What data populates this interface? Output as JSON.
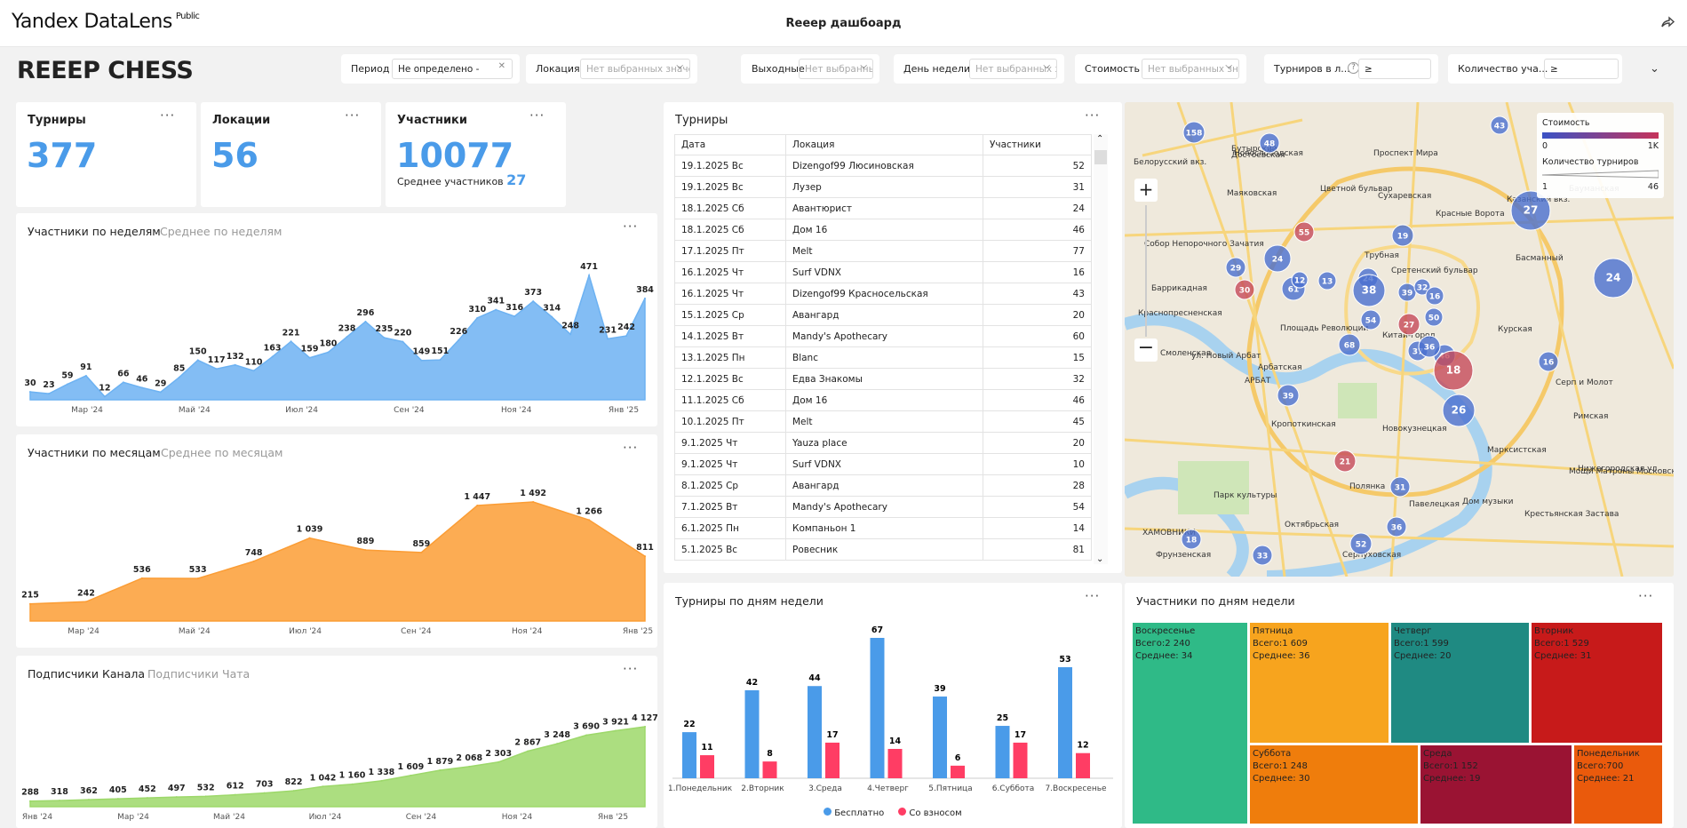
{
  "app": {
    "logo": "Yandex DataLens",
    "logo_badge": "Public",
    "title": "Reeep дашбоард",
    "brand": "REEEP CHESS"
  },
  "filters": [
    {
      "label": "Период",
      "value": "Не определено - Не определено",
      "clear": "✕"
    },
    {
      "label": "Локация",
      "placeholder": "Нет выбранных значений"
    },
    {
      "label": "Выходные",
      "placeholder": "Нет выбранных значений"
    },
    {
      "label": "День недели",
      "placeholder": "Нет выбранных значений"
    },
    {
      "label": "Стоимость",
      "placeholder": "Нет выбранных значений"
    },
    {
      "label": "Турниров в л...",
      "value": "≥"
    },
    {
      "label": "Количество уча...",
      "value": "≥"
    }
  ],
  "kpi": {
    "tournaments_label": "Турниры",
    "tournaments_value": "377",
    "locations_label": "Локации",
    "locations_value": "56",
    "participants_label": "Участники",
    "participants_value": "10077",
    "avg_label": "Среднее участников",
    "avg_value": "27"
  },
  "weekly": {
    "tab1": "Участники по неделям",
    "tab2": "Среднее по неделям"
  },
  "monthly": {
    "tab1": "Участники по месяцам",
    "tab2": "Среднее по месяцам"
  },
  "subs": {
    "tab1": "Подписчики Канала",
    "tab2": "Подписчики Чата"
  },
  "table": {
    "title": "Турниры",
    "headers": [
      "Дата",
      "Локация",
      "Участники"
    ],
    "rows": [
      [
        "19.1.2025 Вс",
        "Dizengof99 Люсиновская",
        "52"
      ],
      [
        "19.1.2025 Вс",
        "Лузер",
        "31"
      ],
      [
        "18.1.2025 Сб",
        "Авантюрист",
        "24"
      ],
      [
        "18.1.2025 Сб",
        "Дом 16",
        "46"
      ],
      [
        "17.1.2025 Пт",
        "Melt",
        "77"
      ],
      [
        "16.1.2025 Чт",
        "Surf VDNX",
        "16"
      ],
      [
        "16.1.2025 Чт",
        "Dizengof99 Красносельская",
        "43"
      ],
      [
        "15.1.2025 Ср",
        "Авангард",
        "20"
      ],
      [
        "14.1.2025 Вт",
        "Mandy's Apothecary",
        "60"
      ],
      [
        "13.1.2025 Пн",
        "Blanc",
        "15"
      ],
      [
        "12.1.2025 Вс",
        "Едва Знакомы",
        "32"
      ],
      [
        "11.1.2025 Сб",
        "Дом 16",
        "46"
      ],
      [
        "10.1.2025 Пт",
        "Melt",
        "45"
      ],
      [
        "9.1.2025 Чт",
        "Yauza place",
        "20"
      ],
      [
        "9.1.2025 Чт",
        "Surf VDNX",
        "10"
      ],
      [
        "8.1.2025 Ср",
        "Авангард",
        "28"
      ],
      [
        "7.1.2025 Вт",
        "Mandy's Apothecary",
        "54"
      ],
      [
        "6.1.2025 Пн",
        "Компаньон 1",
        "14"
      ],
      [
        "5.1.2025 Вс",
        "Ровесник",
        "81"
      ]
    ]
  },
  "map": {
    "legend_cost": "Стоимость",
    "cost_min": "0",
    "cost_max": "1K",
    "legend_count": "Количество турниров",
    "count_min": "1",
    "count_max": "46",
    "labels": [
      "Бутырский",
      "Новослободская",
      "Достоевская",
      "Проспект Мира",
      "Белорусский вкз.",
      "Маяковская",
      "Цветной бульвар",
      "Сухаревская",
      "Красные Ворота",
      "Казанский вкз.",
      "Бауманская",
      "Собор Непорочного Зачатия",
      "Трубная",
      "Баррикадная",
      "Краснопресненская",
      "Сретенский бульвар",
      "Площадь Революции",
      "Китай-город",
      "Курская",
      "Басманный",
      "Смоленская",
      "Арбатская",
      "ул. Новый Арбат",
      "АРБАТ",
      "Серп и Молот",
      "Кропоткинская",
      "Новокузнецкая",
      "Марксистская",
      "Парк культуры",
      "Полянка",
      "Павелецкая",
      "Крестьянская Застава",
      "Октябрьская",
      "ХАМОВНИКИ",
      "Серпуховская",
      "Фрунзенская",
      "Мощи Матроны Московской",
      "Дом музыки",
      "Римская",
      "Нижегородская ул."
    ],
    "bubbles": [
      "158",
      "48",
      "43",
      "27",
      "55",
      "19",
      "24",
      "29",
      "30",
      "61",
      "12",
      "13",
      "24",
      "38",
      "39",
      "32",
      "16",
      "24",
      "54",
      "27",
      "50",
      "68",
      "37",
      "46",
      "18",
      "36",
      "16",
      "39",
      "26",
      "21",
      "31",
      "36",
      "18",
      "52",
      "33"
    ]
  },
  "dow": {
    "title": "Турниры по дням недели",
    "legend_free": "Бесплатно",
    "legend_paid": "Со взносом"
  },
  "tree": {
    "title": "Участники по дням недели",
    "tiles": [
      {
        "name": "Воскресенье",
        "total": "Всего:2 240",
        "avg": "Среднее: 34"
      },
      {
        "name": "Пятница",
        "total": "Всего:1 609",
        "avg": "Среднее: 36"
      },
      {
        "name": "Четверг",
        "total": "Всего:1 599",
        "avg": "Среднее: 20"
      },
      {
        "name": "Вторник",
        "total": "Всего:1 529",
        "avg": "Среднее: 31"
      },
      {
        "name": "Суббота",
        "total": "Всего:1 248",
        "avg": "Среднее: 30"
      },
      {
        "name": "Среда",
        "total": "Всего:1 152",
        "avg": "Среднее: 19"
      },
      {
        "name": "Понедельник",
        "total": "Всего:700",
        "avg": "Среднее: 21"
      }
    ]
  },
  "colors": {
    "blue": "#4a9be9",
    "weekly": "#6db2f2",
    "monthly": "#fb9d35",
    "subs": "#9dd86a",
    "red": "#ff3d64"
  },
  "chart_data": [
    {
      "type": "area",
      "title": "Участники по неделям",
      "x_ticks": [
        "Мар '24",
        "Май '24",
        "Июл '24",
        "Сен '24",
        "Ноя '24",
        "Янв '25"
      ],
      "values": [
        30,
        23,
        59,
        91,
        12,
        66,
        46,
        29,
        85,
        150,
        117,
        132,
        110,
        163,
        221,
        159,
        180,
        238,
        296,
        235,
        220,
        149,
        151,
        226,
        310,
        341,
        316,
        373,
        314,
        248,
        471,
        231,
        242,
        384
      ],
      "labels": [
        "30",
        "23",
        "59",
        "91",
        "12",
        "66",
        "46",
        "29",
        "85",
        "150",
        "117",
        "132",
        "110",
        "163",
        "221",
        "159",
        "180",
        "238",
        "296",
        "235",
        "220",
        "149",
        "151",
        "226",
        "310",
        "341",
        "316",
        "373",
        "314",
        "248",
        "471",
        "231",
        "242",
        "384"
      ]
    },
    {
      "type": "area",
      "title": "Участники по месяцам",
      "x_ticks": [
        "Мар '24",
        "Май '24",
        "Июл '24",
        "Сен '24",
        "Ноя '24",
        "Янв '25"
      ],
      "values": [
        215,
        242,
        536,
        533,
        748,
        1039,
        889,
        859,
        1447,
        1492,
        1266,
        811
      ],
      "labels": [
        "215",
        "242",
        "536",
        "533",
        "748",
        "1 039",
        "889",
        "859",
        "1 447",
        "1 492",
        "1 266",
        "811"
      ]
    },
    {
      "type": "area",
      "title": "Подписчики Канала",
      "x_ticks": [
        "Янв '24",
        "Мар '24",
        "Май '24",
        "Июл '24",
        "Сен '24",
        "Ноя '24",
        "Янв '25"
      ],
      "values": [
        288,
        318,
        362,
        405,
        452,
        497,
        532,
        612,
        703,
        822,
        1042,
        1160,
        1338,
        1609,
        1879,
        2068,
        2303,
        2867,
        3248,
        3690,
        3921,
        4127
      ],
      "labels": [
        "288",
        "318",
        "362",
        "405",
        "452",
        "497",
        "532",
        "612",
        "703",
        "822",
        "1 042",
        "1 160",
        "1 338",
        "1 609",
        "1 879",
        "2 068",
        "2 303",
        "2 867",
        "3 248",
        "3 690",
        "3 921",
        "4 127"
      ]
    },
    {
      "type": "bar",
      "title": "Турниры по дням недели",
      "categories": [
        "1.Понедельник",
        "2.Вторник",
        "3.Среда",
        "4.Четверг",
        "5.Пятница",
        "6.Суббота",
        "7.Воскресенье"
      ],
      "series": [
        {
          "name": "Бесплатно",
          "values": [
            22,
            42,
            44,
            67,
            39,
            25,
            53
          ]
        },
        {
          "name": "Со взносом",
          "values": [
            11,
            8,
            17,
            14,
            6,
            17,
            12
          ]
        }
      ]
    }
  ]
}
